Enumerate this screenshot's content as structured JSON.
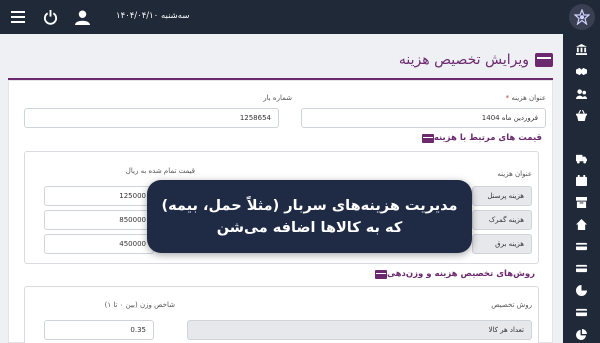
{
  "topbar": {
    "date": "سه‌شنبه ۱۴۰۴/۰۴/۱۰",
    "icons": [
      "menu-icon",
      "power-icon",
      "user-icon",
      "logo-icon"
    ]
  },
  "sidebar": {
    "icons": [
      "bank-icon",
      "handshake-icon",
      "users-icon",
      "basket-icon",
      "truck-icon",
      "calendar-icon",
      "box-icon",
      "home-icon",
      "card-icon",
      "card-icon",
      "chart-pie-icon",
      "card-icon",
      "pie-chart-icon"
    ]
  },
  "page": {
    "title": "ویرایش تخصیص هزینه"
  },
  "form": {
    "cost_title_label": "عنوان هزینه",
    "cost_title_required": "*",
    "cost_title_value": "فروردین ماه 1404",
    "load_number_label": "شماره بار",
    "load_number_value": "1258654"
  },
  "related_costs": {
    "section_title": "قیمت های مرتبط با هزینه",
    "col_cost_title": "عنوان هزینه",
    "col_price": "قیمت تمام شده به ریال",
    "rows": [
      {
        "name": "هزینه پرسنل",
        "price": "125000"
      },
      {
        "name": "هزینه گمرک",
        "price": "850000"
      },
      {
        "name": "هزینه برق",
        "price": "450000"
      }
    ]
  },
  "allocation": {
    "section_title": "روش‌های تخصیص هزینه و وزن‌دهی",
    "method_label": "روش تخصیص",
    "weight_label": "شاخص وزن (بین ۰ تا ۱)",
    "method_value": "تعداد هر کالا",
    "weight_value": "0.35"
  },
  "tooltip": {
    "line1": "مدیریت هزینه‌های سربار (مثلاً حمل، بیمه)",
    "line2": "که به کالاها اضافه می‌شن"
  },
  "colors": {
    "topbar": "#1f2937",
    "accent": "#6b2a6e",
    "tooltip_bg": "#1f2a44"
  }
}
